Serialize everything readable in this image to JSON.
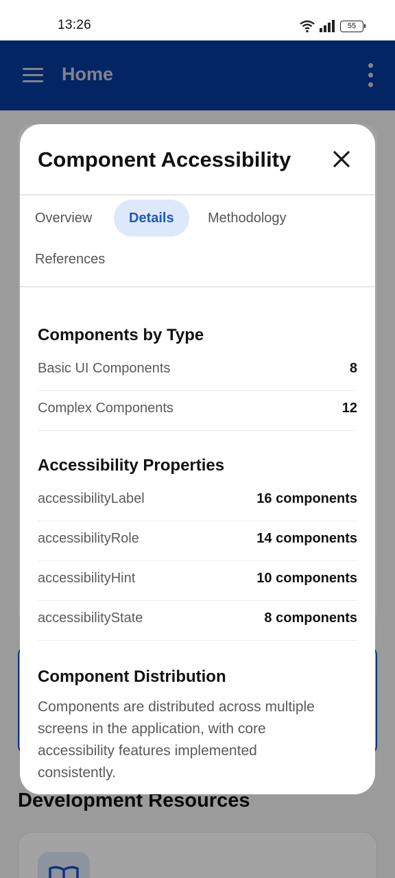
{
  "status_bar": {
    "time": "13:26",
    "battery": "55"
  },
  "app_bar": {
    "title": "Home"
  },
  "background": {
    "section_heading": "Development Resources"
  },
  "modal": {
    "title": "Component Accessibility",
    "tabs": [
      {
        "label": "Overview",
        "active": false
      },
      {
        "label": "Details",
        "active": true
      },
      {
        "label": "Methodology",
        "active": false
      },
      {
        "label": "References",
        "active": false
      }
    ],
    "sections": [
      {
        "title": "Components by Type",
        "rows": [
          {
            "label": "Basic UI Components",
            "value": "8"
          },
          {
            "label": "Complex Components",
            "value": "12"
          }
        ]
      },
      {
        "title": "Accessibility Properties",
        "rows": [
          {
            "label": "accessibilityLabel",
            "value": "16 components"
          },
          {
            "label": "accessibilityRole",
            "value": "14 components"
          },
          {
            "label": "accessibilityHint",
            "value": "10 components"
          },
          {
            "label": "accessibilityState",
            "value": "8 components"
          }
        ]
      }
    ],
    "distribution": {
      "title": "Component Distribution",
      "text": "Components are distributed across multiple screens in the application, with core accessibility features implemented consistently."
    }
  },
  "colors": {
    "app_bar": "#063a9c",
    "tab_active_bg": "#dde9fb",
    "tab_active_text": "#1c57c3"
  }
}
